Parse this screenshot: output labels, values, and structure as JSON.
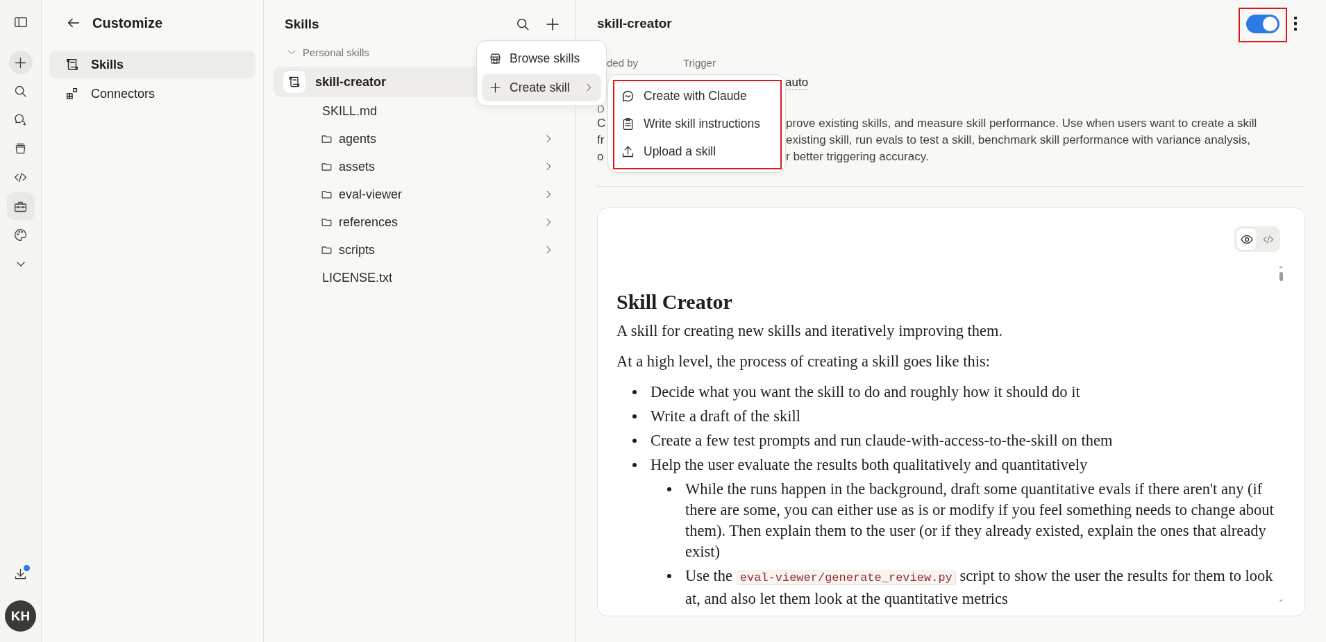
{
  "rail": {
    "items": [
      {
        "selected": false
      },
      {
        "selected": false
      },
      {
        "selected": false
      },
      {
        "selected": false
      },
      {
        "selected": false
      },
      {
        "selected": true
      },
      {
        "selected": false
      }
    ],
    "download_badge": true,
    "avatar": "KH"
  },
  "customize": {
    "title": "Customize",
    "items": [
      {
        "label": "Skills",
        "selected": true
      },
      {
        "label": "Connectors",
        "selected": false
      }
    ]
  },
  "skills_panel": {
    "title": "Skills",
    "section": {
      "label": "Personal skills",
      "expanded": true
    },
    "skill": {
      "name": "skill-creator",
      "selected": true
    },
    "files": [
      {
        "kind": "file",
        "name": "SKILL.md"
      },
      {
        "kind": "folder",
        "name": "agents"
      },
      {
        "kind": "folder",
        "name": "assets"
      },
      {
        "kind": "folder",
        "name": "eval-viewer"
      },
      {
        "kind": "folder",
        "name": "references"
      },
      {
        "kind": "folder",
        "name": "scripts"
      },
      {
        "kind": "file",
        "name": "LICENSE.txt"
      }
    ]
  },
  "add_menu": {
    "items": [
      {
        "label": "Browse skills",
        "selected": false,
        "submenu": false
      },
      {
        "label": "Create skill",
        "selected": true,
        "submenu": true
      }
    ]
  },
  "submenu": {
    "annotated": true,
    "items": [
      {
        "label": "Create with Claude"
      },
      {
        "label": "Write skill instructions"
      },
      {
        "label": "Upload a skill"
      }
    ]
  },
  "detail": {
    "title": "skill-creator",
    "toggle": {
      "on": true,
      "annotated": true
    },
    "meta": [
      {
        "label": "ded by"
      },
      {
        "label": "Trigger",
        "value": "auto"
      }
    ],
    "description_label": "D",
    "description_lines": [
      {
        "start": "C",
        "end": "prove existing skills, and measure skill performance. Use when users want to create a skill"
      },
      {
        "start": "fr",
        "end": "existing skill, run evals to test a skill, benchmark skill performance with variance analysis,"
      },
      {
        "start": "o",
        "end": "r better triggering accuracy."
      }
    ]
  },
  "document": {
    "view_buttons": [
      {
        "selected": true
      },
      {
        "selected": false
      }
    ],
    "heading": "Skill Creator",
    "blocks": [
      {
        "kind": "paragraph",
        "text": "A skill for creating new skills and iteratively improving them."
      },
      {
        "kind": "paragraph",
        "text": "At a high level, the process of creating a skill goes like this:"
      },
      {
        "kind": "bullet",
        "text": "Decide what you want the skill to do and roughly how it should do it"
      },
      {
        "kind": "bullet",
        "text": "Write a draft of the skill"
      },
      {
        "kind": "bullet",
        "text": "Create a few test prompts and run claude-with-access-to-the-skill on them"
      },
      {
        "kind": "bullet",
        "text": "Help the user evaluate the results both qualitatively and quantitatively",
        "children": [
          {
            "parts": [
              {
                "kind": "text",
                "text": "While the runs happen in the background, draft some quantitative evals if there aren't any (if there are some, you can either use as is or modify if you feel something needs to change about them). Then explain them to the user (or if they already existed, explain the ones that already exist)"
              }
            ]
          },
          {
            "parts": [
              {
                "kind": "text",
                "text": "Use the "
              },
              {
                "kind": "code",
                "text": "eval-viewer/generate_review.py"
              },
              {
                "kind": "text",
                "text": " script to show the user the results for them to look at, and also let them look at the quantitative metrics"
              }
            ]
          }
        ]
      }
    ]
  }
}
